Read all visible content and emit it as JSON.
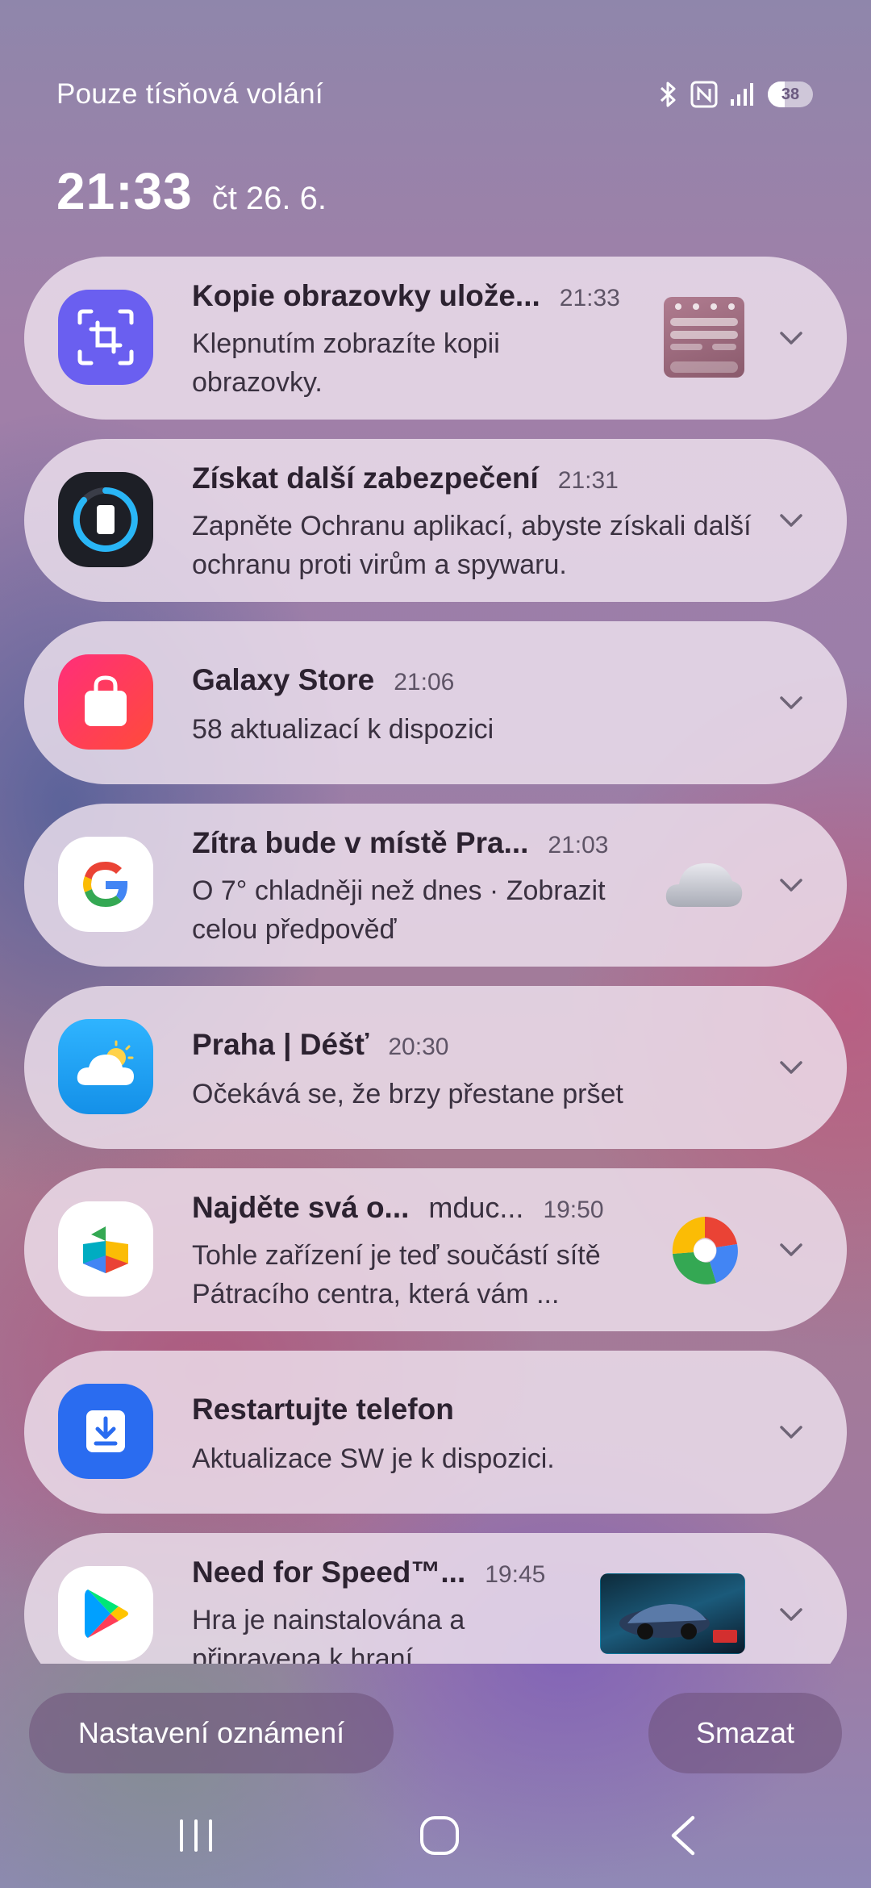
{
  "status_bar": {
    "carrier_text": "Pouze tísňová volání",
    "icons": [
      "bluetooth-icon",
      "nfc-icon",
      "signal-icon",
      "battery-icon"
    ],
    "battery_level": 38,
    "battery_label": "38"
  },
  "clock": {
    "time": "21:33",
    "date": "čt 26. 6."
  },
  "notifications": [
    {
      "app_icon": "screenshot-app-icon",
      "title": "Kopie obrazovky ulože...",
      "time": "21:33",
      "body": "Klepnutím zobrazíte kopii obrazovky.",
      "thumbnail": "screenshot-thumbnail"
    },
    {
      "app_icon": "device-security-icon",
      "title": "Získat další zabezpečení",
      "time": "21:31",
      "body": "Zapněte Ochranu aplikací, abyste získali další ochranu proti virům a spywaru."
    },
    {
      "app_icon": "galaxy-store-icon",
      "title": "Galaxy Store",
      "time": "21:06",
      "body": "58 aktualizací k dispozici"
    },
    {
      "app_icon": "google-icon",
      "title": "Zítra bude v místě Pra...",
      "time": "21:03",
      "body": "O 7° chladněji než dnes · Zobrazit celou předpověď",
      "thumbnail": "cloud-icon"
    },
    {
      "app_icon": "weather-icon",
      "title": "Praha | Déšť",
      "time": "20:30",
      "body": "Očekává se, že brzy přestane pršet"
    },
    {
      "app_icon": "google-play-services-icon",
      "title": "Najděte svá o...",
      "subtitle": "mduc...",
      "time": "19:50",
      "body": "Tohle zařízení je teď součástí sítě Pátracího centra, která vám ...",
      "thumbnail": "find-hub-icon"
    },
    {
      "app_icon": "software-update-icon",
      "title": "Restartujte telefon",
      "time": "",
      "body": "Aktualizace SW je k dispozici."
    },
    {
      "app_icon": "google-play-icon",
      "title": "Need for Speed™...",
      "time": "19:45",
      "body": "Hra je nainstalována a připravena k hraní.",
      "thumbnail": "game-thumbnail"
    }
  ],
  "buttons": {
    "settings": "Nastavení oznámení",
    "clear": "Smazat"
  },
  "navbar": [
    "recents-icon",
    "home-icon",
    "back-icon"
  ],
  "colors": {
    "card_bg": "#eee2ee",
    "title_text": "#2c2230",
    "body_text": "#3a3140",
    "button_bg": "#6e5078"
  }
}
